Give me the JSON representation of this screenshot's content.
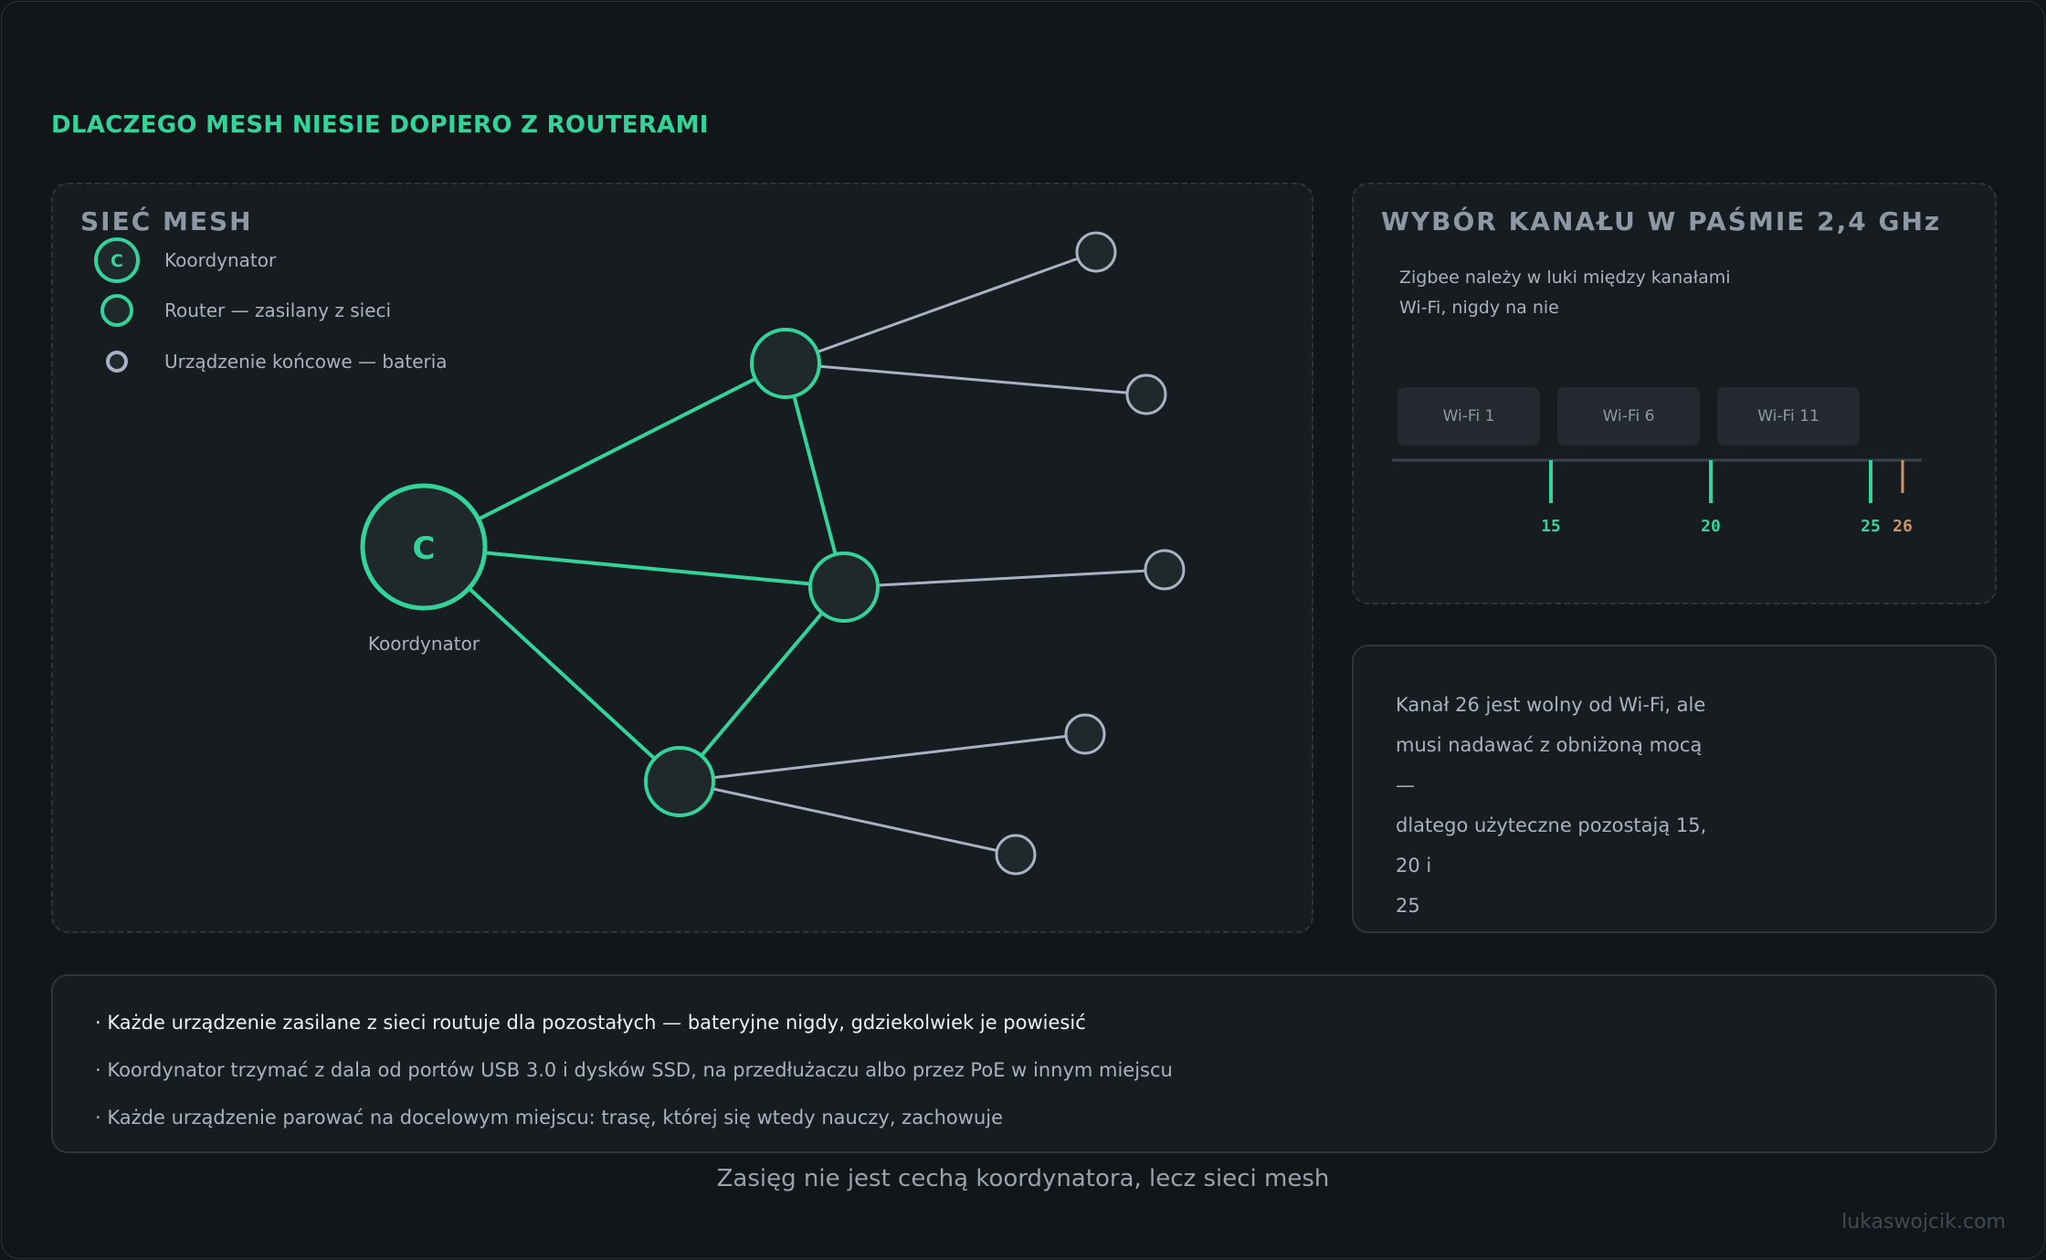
{
  "title": "DLACZEGO MESH NIESIE DOPIERO Z ROUTERAMI",
  "mesh_panel": {
    "title": "SIEĆ MESH",
    "legend": {
      "coordinator": "Koordynator",
      "coordinator_glyph": "C",
      "router": "Router — zasilany z sieci",
      "end_device": "Urządzenie końcowe — bateria"
    },
    "coordinator_label": "Koordynator",
    "coordinator_glyph": "C",
    "colors": {
      "router": "#34d39a",
      "end_device": "#a9b2c4",
      "node_fill": "#1f282b"
    }
  },
  "channel_panel": {
    "title": "WYBÓR KANAŁU W PAŚMIE 2,4 GHz",
    "subtitle_line1": "Zigbee należy w luki między kanałami",
    "subtitle_line2": "Wi-Fi, nigdy na nie",
    "wifi_channels": [
      "Wi-Fi 1",
      "Wi-Fi 6",
      "Wi-Fi 11"
    ],
    "zigbee_channels": [
      {
        "label": "15",
        "color": "#34d39a"
      },
      {
        "label": "20",
        "color": "#34d39a"
      },
      {
        "label": "25",
        "color": "#34d39a"
      },
      {
        "label": "26",
        "color": "#c8946a"
      }
    ]
  },
  "note": {
    "line1": "Kanał 26 jest wolny od Wi-Fi, ale",
    "line2": "musi nadawać z obniżoną mocą —",
    "line3": "dlatego użyteczne pozostają 15, 20 i",
    "line4": "25"
  },
  "bullets": [
    "· Każde urządzenie zasilane z sieci routuje dla pozostałych — bateryjne nigdy, gdziekolwiek je powiesić",
    "· Koordynator trzymać z dala od portów USB 3.0 i dysków SSD, na przedłużaczu albo przez PoE w innym miejscu",
    "· Każde urządzenie parować na docelowym miejscu: trasę, której się wtedy nauczy, zachowuje"
  ],
  "caption": "Zasięg nie jest cechą koordynatora, lecz sieci mesh",
  "credit": "lukaswojcik.com"
}
